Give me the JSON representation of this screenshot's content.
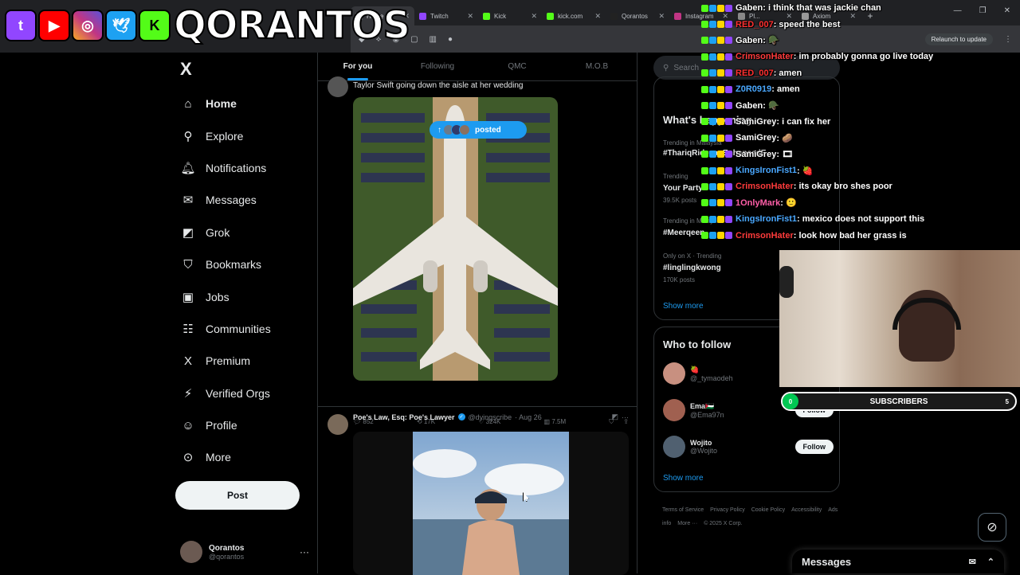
{
  "overlay": {
    "brand": "QORANTOS",
    "logo_icons": [
      "twitch-icon",
      "youtube-icon",
      "instagram-icon",
      "twitter-bird-icon",
      "kick-icon"
    ],
    "colors": {
      "twitch": "#9146ff",
      "youtube": "#ff0000",
      "instagram": "#c13584",
      "twitter": "#1da1f2",
      "kick": "#53fc18"
    }
  },
  "browser": {
    "tabs": [
      {
        "label": "Home /",
        "active": true,
        "color": "#e7e9ea"
      },
      {
        "label": "Twitch",
        "active": false,
        "color": "#9146ff"
      },
      {
        "label": "Kick",
        "active": false,
        "color": "#53fc18"
      },
      {
        "label": "kick.com",
        "active": false,
        "color": "#53fc18"
      },
      {
        "label": "Qorantos",
        "active": false,
        "color": "#222"
      },
      {
        "label": "Instagram",
        "active": false,
        "color": "#c13584"
      },
      {
        "label": "Pl...",
        "active": false,
        "color": "#888"
      },
      {
        "label": "Axiom",
        "active": false,
        "color": "#999"
      }
    ],
    "relaunch_label": "Relaunch to update"
  },
  "sidebar": {
    "logo": "X",
    "items": [
      {
        "label": "Home",
        "icon": "home-icon",
        "glyph": "⌂",
        "bold": true
      },
      {
        "label": "Explore",
        "icon": "search-icon",
        "glyph": "⚲",
        "bold": false
      },
      {
        "label": "Notifications",
        "icon": "bell-icon",
        "glyph": "🔔︎",
        "bold": false
      },
      {
        "label": "Messages",
        "icon": "envelope-icon",
        "glyph": "✉",
        "bold": false
      },
      {
        "label": "Grok",
        "icon": "grok-icon",
        "glyph": "◩",
        "bold": false
      },
      {
        "label": "Bookmarks",
        "icon": "bookmark-icon",
        "glyph": "⛉",
        "bold": false
      },
      {
        "label": "Jobs",
        "icon": "briefcase-icon",
        "glyph": "▣",
        "bold": false
      },
      {
        "label": "Communities",
        "icon": "people-icon",
        "glyph": "☷",
        "bold": false
      },
      {
        "label": "Premium",
        "icon": "x-premium-icon",
        "glyph": "X",
        "bold": false
      },
      {
        "label": "Verified Orgs",
        "icon": "lightning-icon",
        "glyph": "⚡︎",
        "bold": false
      },
      {
        "label": "Profile",
        "icon": "person-icon",
        "glyph": "☺",
        "bold": false
      },
      {
        "label": "More",
        "icon": "more-circle-icon",
        "glyph": "⊙",
        "bold": false
      }
    ],
    "post_label": "Post",
    "account": {
      "name": "Qorantos",
      "handle": "@qorantos",
      "more": "···"
    }
  },
  "feed": {
    "tabs": [
      {
        "label": "For you",
        "active": true
      },
      {
        "label": "Following",
        "active": false
      },
      {
        "label": "QMC",
        "active": false
      },
      {
        "label": "M.O.B",
        "active": false
      }
    ],
    "posted_pill": "posted",
    "posts": [
      {
        "text": "Taylor Swift going down the aisle at her wedding",
        "stats": {
          "replies": "852",
          "reposts": "17K",
          "likes": "324K",
          "views": "7.5M"
        }
      },
      {
        "name": "Poe's Law, Esq: Poe's Lawyer",
        "handle": "@dyingscribe",
        "date": "· Aug 26"
      }
    ]
  },
  "right": {
    "search_placeholder": "Search",
    "happening_title": "What's happening",
    "trends": [
      {
        "meta": "Trending in Malaysia",
        "name": "#ThariqRidzuanEnhancedE"
      },
      {
        "meta": "Trending",
        "name": "Your Party",
        "count": "39.5K posts"
      },
      {
        "meta": "Trending in Malaysia",
        "name": "#Meerqeen"
      },
      {
        "meta": "Only on X · Trending",
        "name": "#linglingkwong",
        "count": "170K posts"
      }
    ],
    "show_more": "Show more",
    "wtf_title": "Who to follow",
    "follow_items": [
      {
        "name": "🍓",
        "handle": "@_tymaodeh",
        "follow": "Follow",
        "color": "#c89080"
      },
      {
        "name": "Ema🇵🇸",
        "handle": "@Ema97n",
        "follow": "Follow",
        "color": "#a06050"
      },
      {
        "name": "Wojito",
        "handle": "@Wojito",
        "follow": "Follow",
        "color": "#506070"
      }
    ],
    "footer": [
      "Terms of Service",
      "Privacy Policy",
      "Cookie Policy",
      "Accessibility",
      "Ads info",
      "More ···",
      "© 2025 X Corp."
    ]
  },
  "chat": [
    {
      "user": "Gaben",
      "color": "#ffffff",
      "text": ": i think that was jackie chan"
    },
    {
      "user": "RED_007",
      "color": "#ff3030",
      "text": ": speed the best"
    },
    {
      "user": "Gaben",
      "color": "#ffffff",
      "text": ": 🪖"
    },
    {
      "user": "CrimsonHater",
      "color": "#ff3b3b",
      "text": ": im probably gonna go live today"
    },
    {
      "user": "RED_007",
      "color": "#ff3030",
      "text": ": amen"
    },
    {
      "user": "Z0R0919",
      "color": "#4aa8ff",
      "text": ": amen"
    },
    {
      "user": "Gaben",
      "color": "#ffffff",
      "text": ": 🪖"
    },
    {
      "user": "SamiGrey",
      "color": "#ffffff",
      "text": ": i can fix her"
    },
    {
      "user": "SamiGrey",
      "color": "#ffffff",
      "text": ": 🥔"
    },
    {
      "user": "SamiGrey",
      "color": "#ffffff",
      "text": ": 🎞"
    },
    {
      "user": "KingsIronFist1",
      "color": "#4aa8ff",
      "text": ": 🍓"
    },
    {
      "user": "CrimsonHater",
      "color": "#ff3b3b",
      "text": ": its okay bro shes poor"
    },
    {
      "user": "1OnlyMark",
      "color": "#ff5fa8",
      "text": ": 🙂"
    },
    {
      "user": "KingsIronFist1",
      "color": "#4aa8ff",
      "text": ": mexico does not support this"
    },
    {
      "user": "CrimsonHater",
      "color": "#ff3b3b",
      "text": ": look how bad her grass is"
    }
  ],
  "subbar": {
    "label": "SUBSCRIBERS",
    "start": "0",
    "end": "5",
    "progress": 0.0
  },
  "messages_drawer": {
    "title": "Messages"
  }
}
